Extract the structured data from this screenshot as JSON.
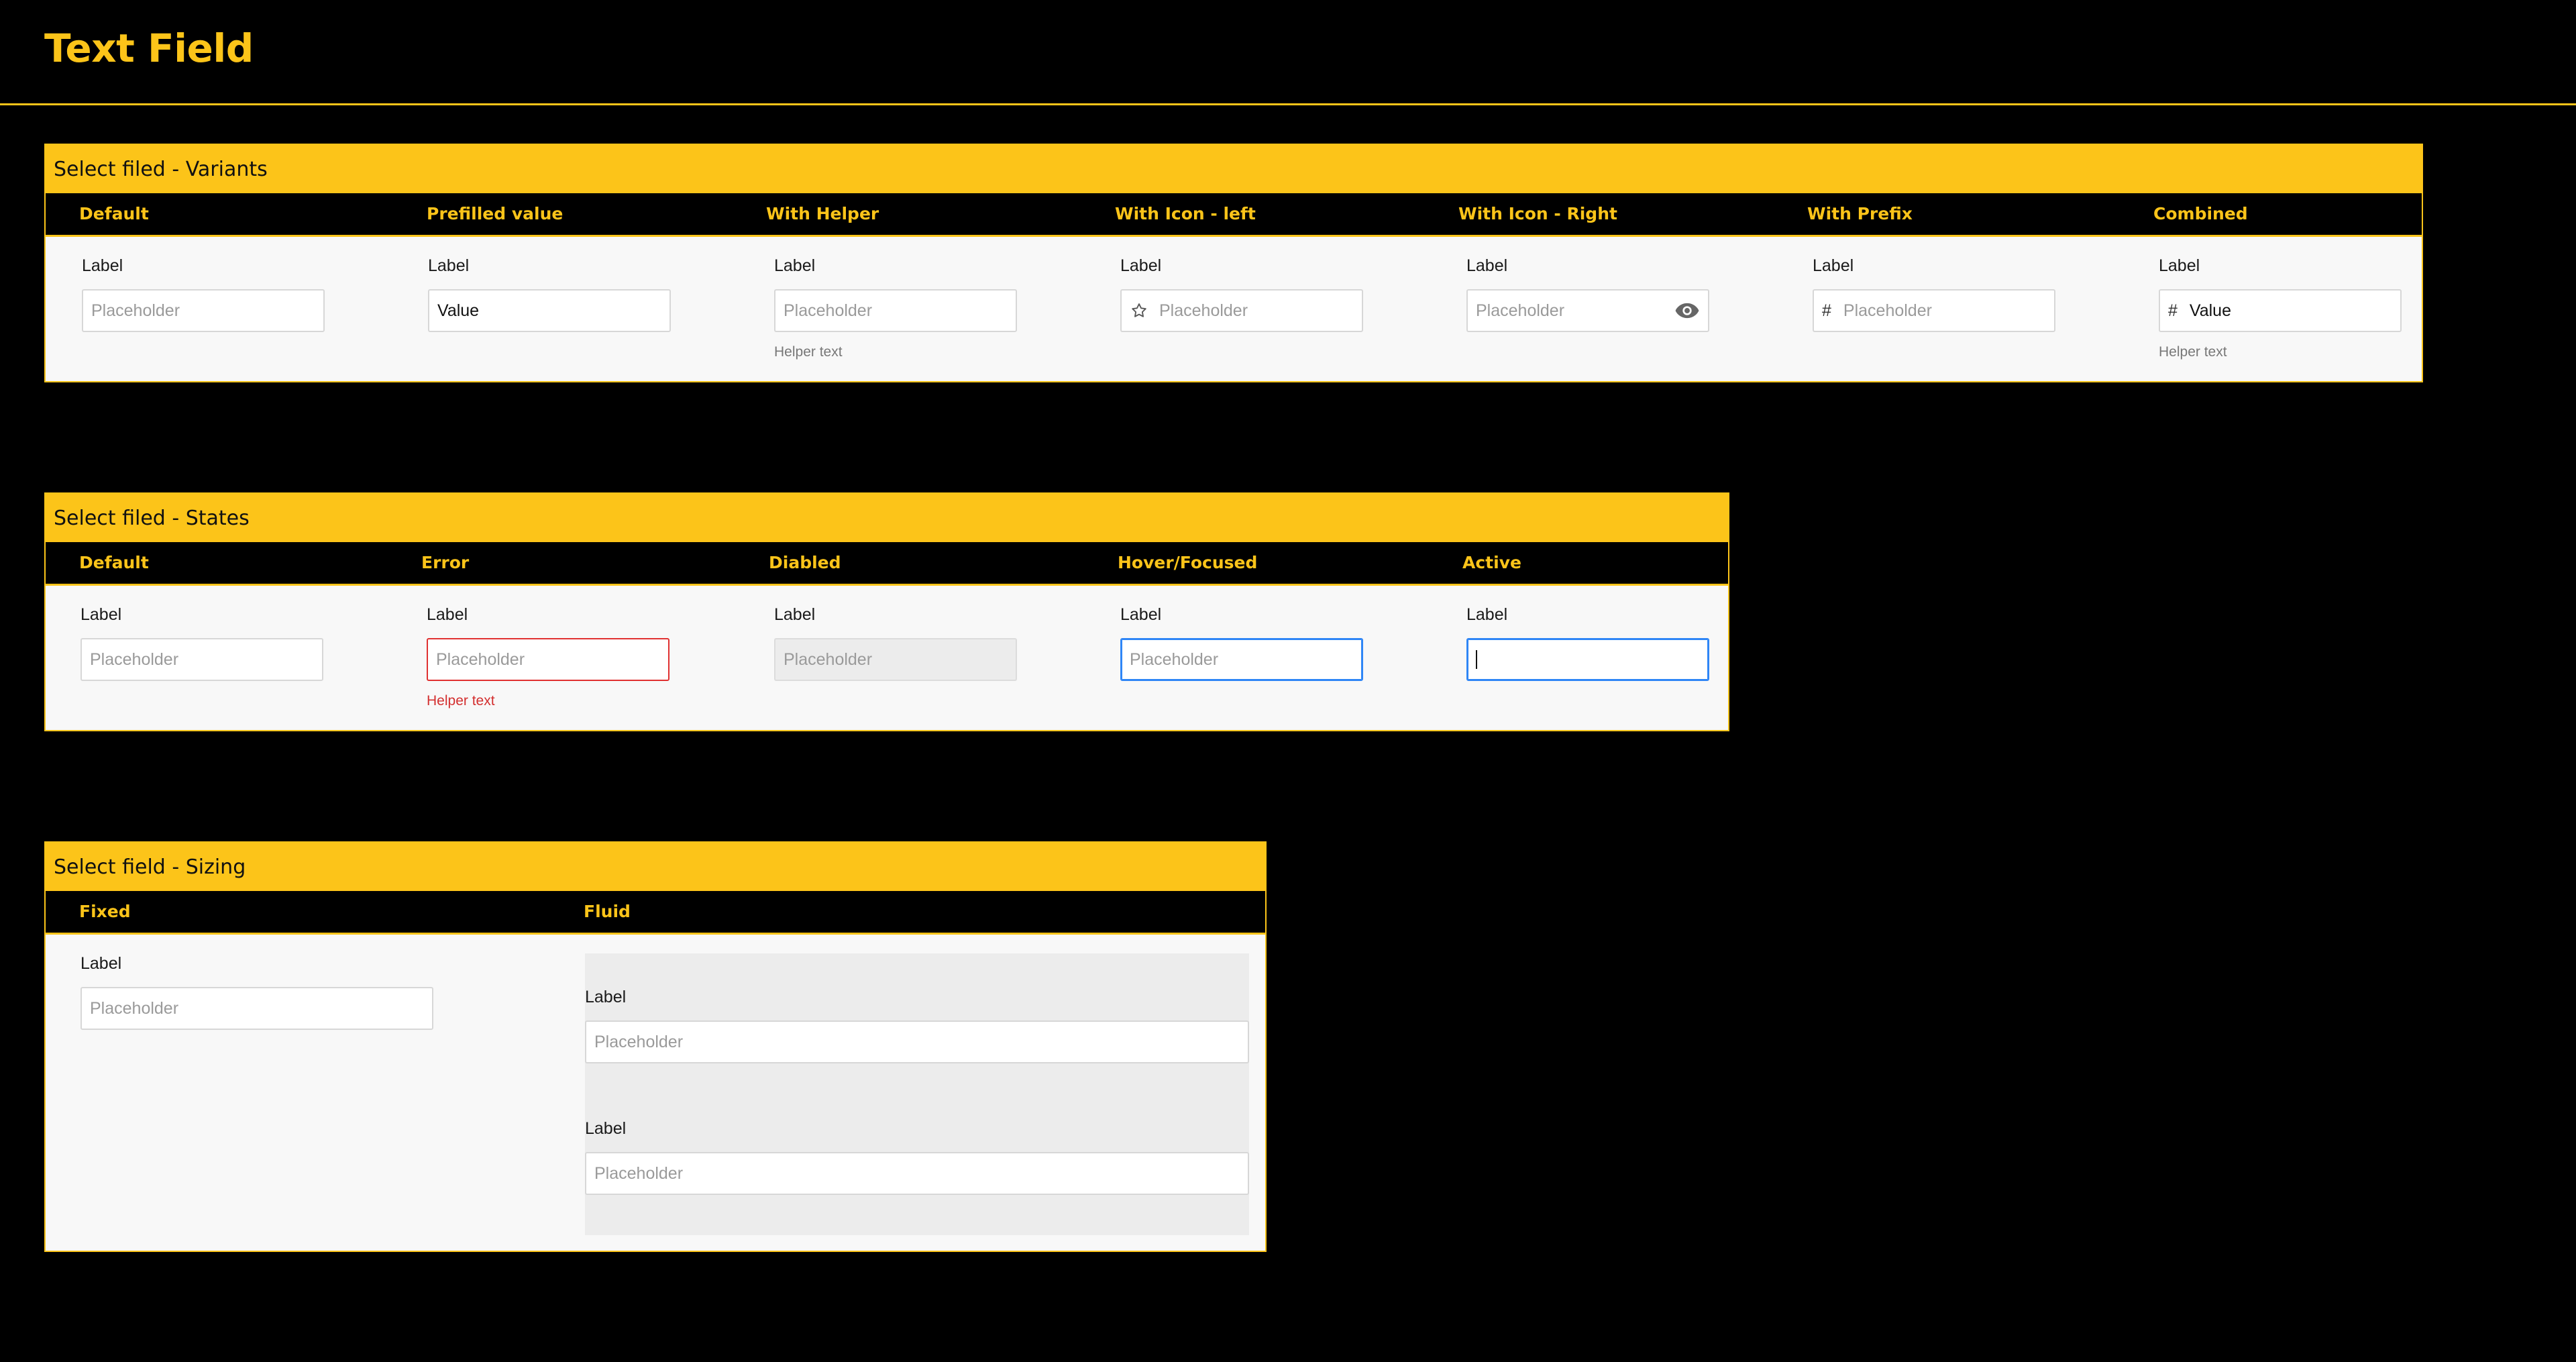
{
  "page": {
    "title": "Text Field"
  },
  "variants": {
    "title": "Select filed - Variants",
    "columns": [
      "Default",
      "Prefilled value",
      "With Helper",
      "With Icon - left",
      "With Icon - Right",
      "With Prefix",
      "Combined"
    ],
    "fields": [
      {
        "label": "Label",
        "placeholder": "Placeholder"
      },
      {
        "label": "Label",
        "value": "Value"
      },
      {
        "label": "Label",
        "placeholder": "Placeholder",
        "helper": "Helper text"
      },
      {
        "label": "Label",
        "placeholder": "Placeholder",
        "icon": "star-outline-icon"
      },
      {
        "label": "Label",
        "placeholder": "Placeholder",
        "icon": "eye-icon"
      },
      {
        "label": "Label",
        "placeholder": "Placeholder",
        "prefix": "#"
      },
      {
        "label": "Label",
        "value": "Value",
        "prefix": "#",
        "helper": "Helper text"
      }
    ]
  },
  "states": {
    "title": "Select filed - States",
    "columns": [
      "Default",
      "Error",
      "Diabled",
      "Hover/Focused",
      "Active"
    ],
    "fields": [
      {
        "label": "Label",
        "placeholder": "Placeholder"
      },
      {
        "label": "Label",
        "placeholder": "Placeholder",
        "helper": "Helper text"
      },
      {
        "label": "Label",
        "placeholder": "Placeholder"
      },
      {
        "label": "Label",
        "placeholder": "Placeholder"
      },
      {
        "label": "Label",
        "value": ""
      }
    ]
  },
  "sizing": {
    "title": "Select field - Sizing",
    "columns": [
      "Fixed",
      "Fluid"
    ],
    "fixed": {
      "label": "Label",
      "placeholder": "Placeholder"
    },
    "fluid": [
      {
        "label": "Label",
        "placeholder": "Placeholder"
      },
      {
        "label": "Label",
        "placeholder": "Placeholder"
      }
    ]
  },
  "colors": {
    "accent": "#fcc419",
    "error": "#e03131",
    "focus": "#2f86f6",
    "disabled_bg": "#ececec"
  }
}
